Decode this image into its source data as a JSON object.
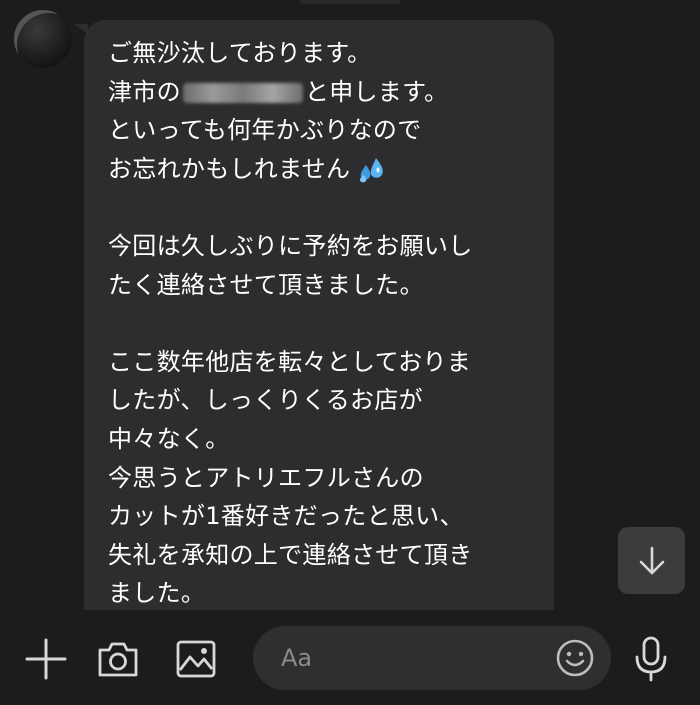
{
  "chat": {
    "message_lines": [
      "ご無沙汰しております。",
      "津市の",
      "と申します。",
      "といっても何年かぶりなので",
      "お忘れかもしれません",
      "",
      "今回は久しぶりに予約をお願いし",
      "たく連絡させて頂きました。",
      "",
      "ここ数年他店を転々としておりま",
      "したが、しっくりくるお店が",
      "中々なく。",
      "今思うとアトリエフルさんの",
      "カットが1番好きだったと思い、",
      "失礼を承知の上で連絡させて頂き",
      "ました。"
    ]
  },
  "input": {
    "placeholder": "Aa"
  },
  "icons": {
    "plus": "plus-icon",
    "camera": "camera-icon",
    "image": "image-icon",
    "emoji": "smiley-icon",
    "mic": "microphone-icon",
    "scroll": "arrow-down-icon",
    "sweat": "sweat-droplets-emoji"
  },
  "colors": {
    "background": "#1c1c1e",
    "bubble": "#2d2d2f",
    "text": "#ffffff",
    "placeholder": "#8a8a8c",
    "icon": "#d8d8d8"
  }
}
